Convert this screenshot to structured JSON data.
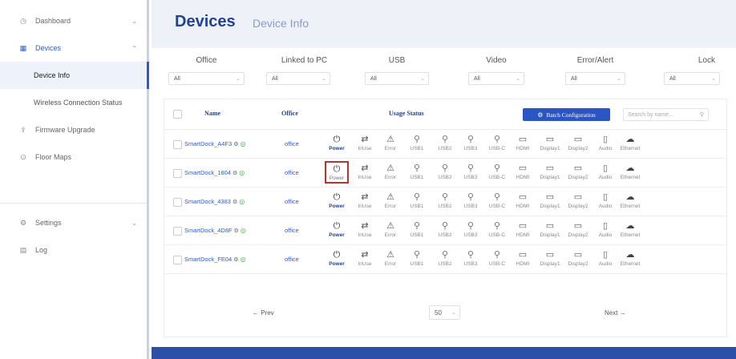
{
  "sidebar": {
    "dashboard": {
      "label": "Dashboard",
      "icon": "dashboard-icon",
      "chevron": "⌄"
    },
    "devices": {
      "label": "Devices",
      "icon": "grid-icon",
      "chevron": "⌃"
    },
    "device_info": "Device Info",
    "wireless": "Wireless Connection Status",
    "firmware": {
      "label": "Firmware Upgrade",
      "icon": "upload-icon"
    },
    "floor_maps": {
      "label": "Floor Maps",
      "icon": "location-pin-icon"
    },
    "settings": {
      "label": "Settings",
      "icon": "gear-icon",
      "chevron": "⌄"
    },
    "log": {
      "label": "Log",
      "icon": "log-icon"
    }
  },
  "header": {
    "title": "Devices",
    "subtitle": "Device Info"
  },
  "filters": [
    {
      "label": "Office",
      "value": "All"
    },
    {
      "label": "Linked to PC",
      "value": "All"
    },
    {
      "label": "USB",
      "value": "All"
    },
    {
      "label": "Video",
      "value": "All"
    },
    {
      "label": "Error/Alert",
      "value": "All"
    },
    {
      "label": "Lock",
      "value": "All"
    }
  ],
  "table": {
    "headers": {
      "name": "Name",
      "office": "Office",
      "usage": "Usage Status"
    },
    "batch_label": "Batch Configuration",
    "search_placeholder": "Search by name...",
    "status_labels": [
      "Power",
      "InUse",
      "Error",
      "USB1",
      "USB2",
      "USB3",
      "USB-C",
      "HDMI",
      "Display1",
      "Display2",
      "Audio",
      "Ethernet"
    ],
    "status_glyphs": [
      "⏻",
      "⇄",
      "⚠",
      "⚲",
      "⚲",
      "⚲",
      "⚲",
      "▭",
      "▭",
      "▭",
      "▯",
      "☁"
    ],
    "rows": [
      {
        "name": "SmartDock_A4F3",
        "office": "office",
        "highlight_power": false
      },
      {
        "name": "SmartDock_1804",
        "office": "office",
        "highlight_power": true
      },
      {
        "name": "SmartDock_4383",
        "office": "office",
        "highlight_power": false
      },
      {
        "name": "SmartDock_4D8F",
        "office": "office",
        "highlight_power": false
      },
      {
        "name": "SmartDock_FE04",
        "office": "office",
        "highlight_power": false
      }
    ]
  },
  "pagination": {
    "prev": "← Prev",
    "next": "Next →",
    "page_size": "50"
  },
  "colors": {
    "accent": "#2c55c4",
    "title": "#23428f",
    "highlight": "#c0302c",
    "online": "#3da84a"
  }
}
